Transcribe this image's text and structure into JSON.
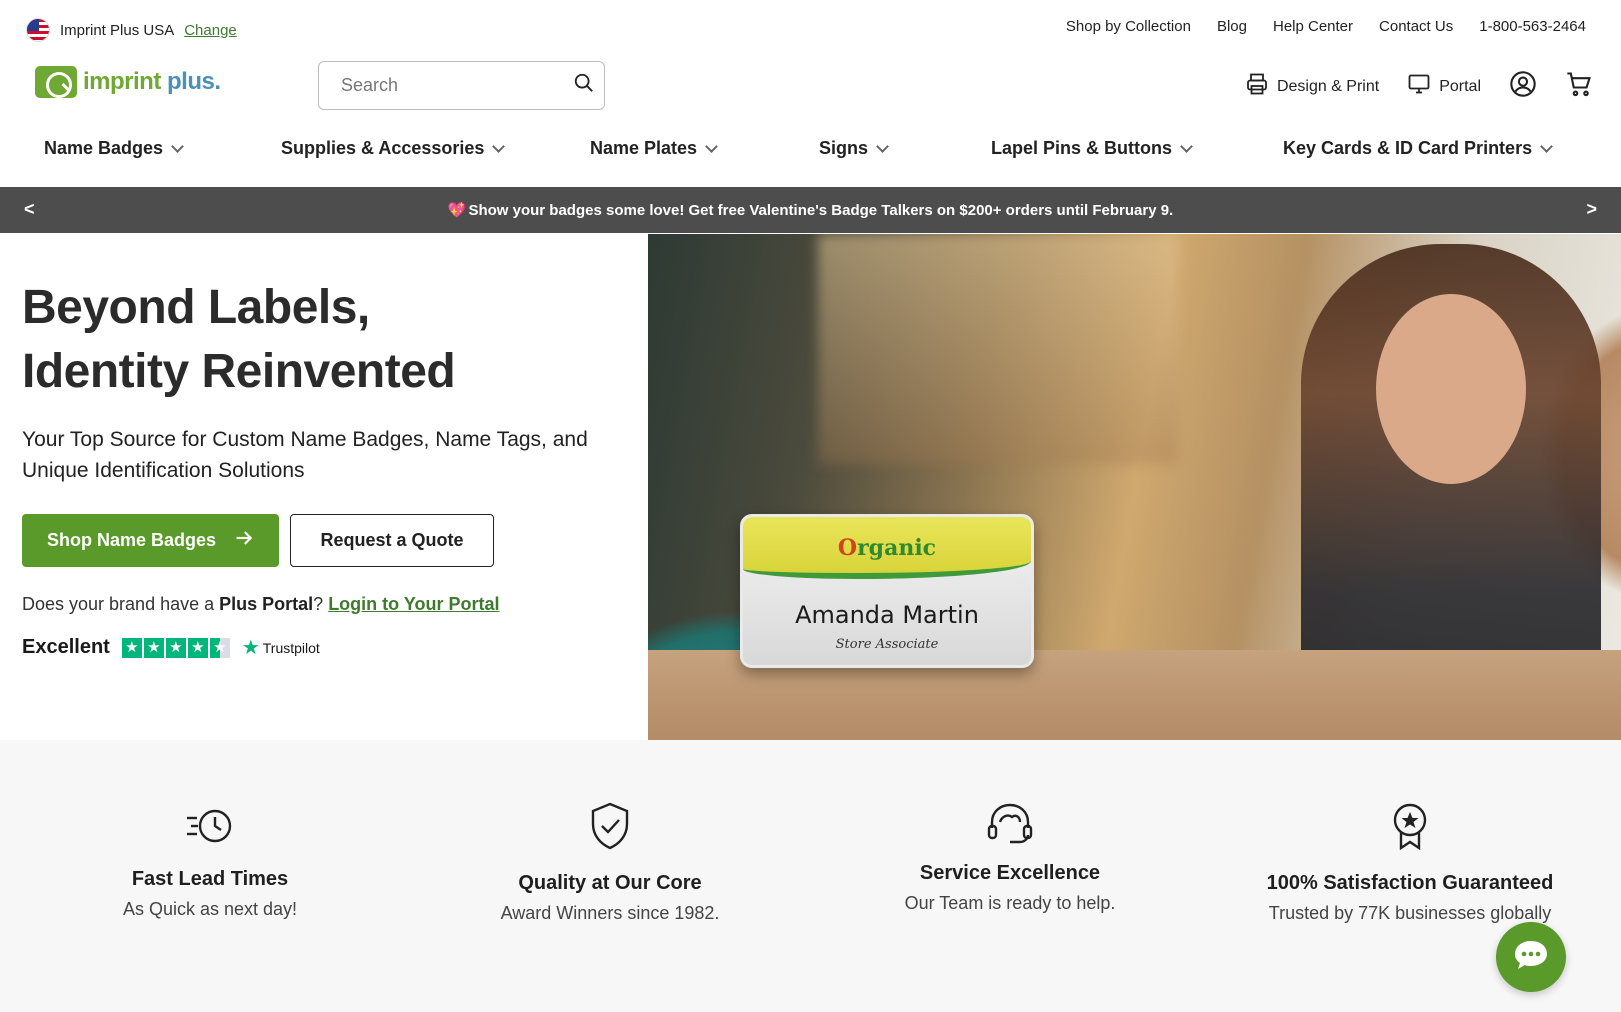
{
  "utility_bar": {
    "region_label": "Imprint Plus USA",
    "change_label": "Change",
    "links": [
      "Shop by Collection",
      "Blog",
      "Help Center",
      "Contact Us",
      "1-800-563-2464"
    ]
  },
  "header": {
    "logo_text_1": "imprint",
    "logo_text_2": "plus",
    "logo_suffix": ".",
    "search_placeholder": "Search",
    "design_print_label": "Design & Print",
    "portal_label": "Portal"
  },
  "main_nav": [
    {
      "label": "Name Badges"
    },
    {
      "label": "Supplies & Accessories"
    },
    {
      "label": "Name Plates"
    },
    {
      "label": "Signs"
    },
    {
      "label": "Lapel Pins & Buttons"
    },
    {
      "label": "Key Cards & ID Card Printers"
    }
  ],
  "promo": {
    "heart": "💖",
    "text": "Show your badges some love! Get free Valentine's Badge Talkers on $200+ orders until February 9.",
    "prev": "<",
    "next": ">"
  },
  "hero": {
    "title_line1": "Beyond Labels,",
    "title_line2": "Identity Reinvented",
    "subtitle": "Your Top Source for Custom Name Badges, Name Tags, and Unique Identification Solutions",
    "primary_cta": "Shop Name Badges",
    "secondary_cta": "Request a Quote",
    "portal_prefix": "Does your brand have a ",
    "portal_bold": "Plus Portal",
    "portal_q": "?",
    "portal_link": "Login to Your Portal",
    "trust_rating_word": "Excellent",
    "trust_stars": 4.5,
    "trust_brand": "Trustpilot"
  },
  "badge": {
    "brand_o": "O",
    "brand_rest": "rganic",
    "name": "Amanda Martin",
    "role": "Store Associate"
  },
  "features": [
    {
      "title": "Fast Lead Times",
      "desc": "As Quick as next day!",
      "icon": "clock-speed-icon"
    },
    {
      "title": "Quality at Our Core",
      "desc": "Award Winners since 1982.",
      "icon": "shield-check-icon"
    },
    {
      "title": "Service Excellence",
      "desc": "Our Team is ready to help.",
      "icon": "headset-icon"
    },
    {
      "title": "100% Satisfaction Guaranteed",
      "desc": "Trusted by 77K businesses globally",
      "icon": "award-ribbon-icon"
    }
  ],
  "colors": {
    "brand_green": "#5a9a2a",
    "link_green": "#3f7a2f",
    "promo_bg": "#4d4d4d",
    "trustpilot_green": "#00b67a"
  }
}
